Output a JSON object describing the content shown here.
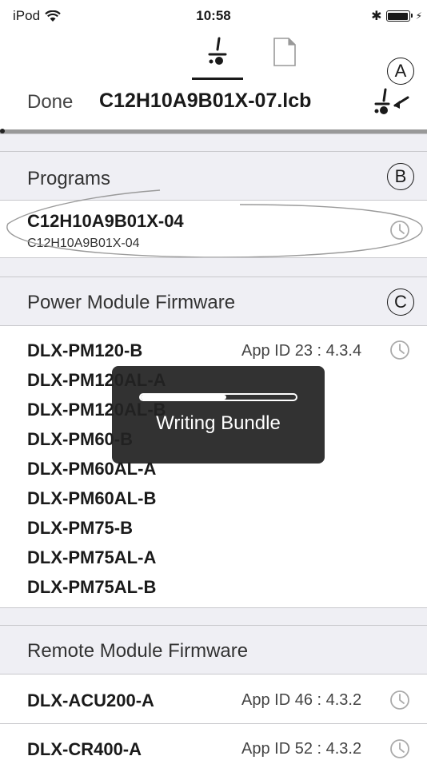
{
  "status_bar": {
    "carrier": "iPod",
    "time": "10:58",
    "bluetooth_glyph": "✱",
    "charging_glyph": "⚡"
  },
  "nav": {
    "done_label": "Done",
    "title": "C12H10A9B01X-07.lcb",
    "tabs": [
      "wheelchair-tab",
      "document-tab"
    ],
    "active_tab": "wheelchair-tab"
  },
  "markers": {
    "a": "A",
    "b": "B",
    "c": "C"
  },
  "programs": {
    "header": "Programs",
    "items": [
      {
        "name": "C12H10A9B01X-04",
        "subtitle": "C12H10A9B01X-04"
      }
    ]
  },
  "power_module": {
    "header": "Power Module Firmware",
    "app_id": "App ID 23 : 4.3.4",
    "items": [
      "DLX-PM120-B",
      "DLX-PM120AL-A",
      "DLX-PM120AL-B",
      "DLX-PM60-B",
      "DLX-PM60AL-A",
      "DLX-PM60AL-B",
      "DLX-PM75-B",
      "DLX-PM75AL-A",
      "DLX-PM75AL-B"
    ]
  },
  "remote_module": {
    "header": "Remote Module Firmware",
    "items": [
      {
        "name": "DLX-ACU200-A",
        "app_id": "App ID 46 : 4.3.2"
      },
      {
        "name": "DLX-CR400-A",
        "app_id": "App ID 52 : 4.3.2"
      }
    ]
  },
  "toast": {
    "label": "Writing Bundle",
    "progress": 0.55
  },
  "colors": {
    "accent": "#1a1a1a",
    "section_bg": "#efeff4",
    "separator": "#c8c8cc",
    "toast_bg": "#222222"
  }
}
